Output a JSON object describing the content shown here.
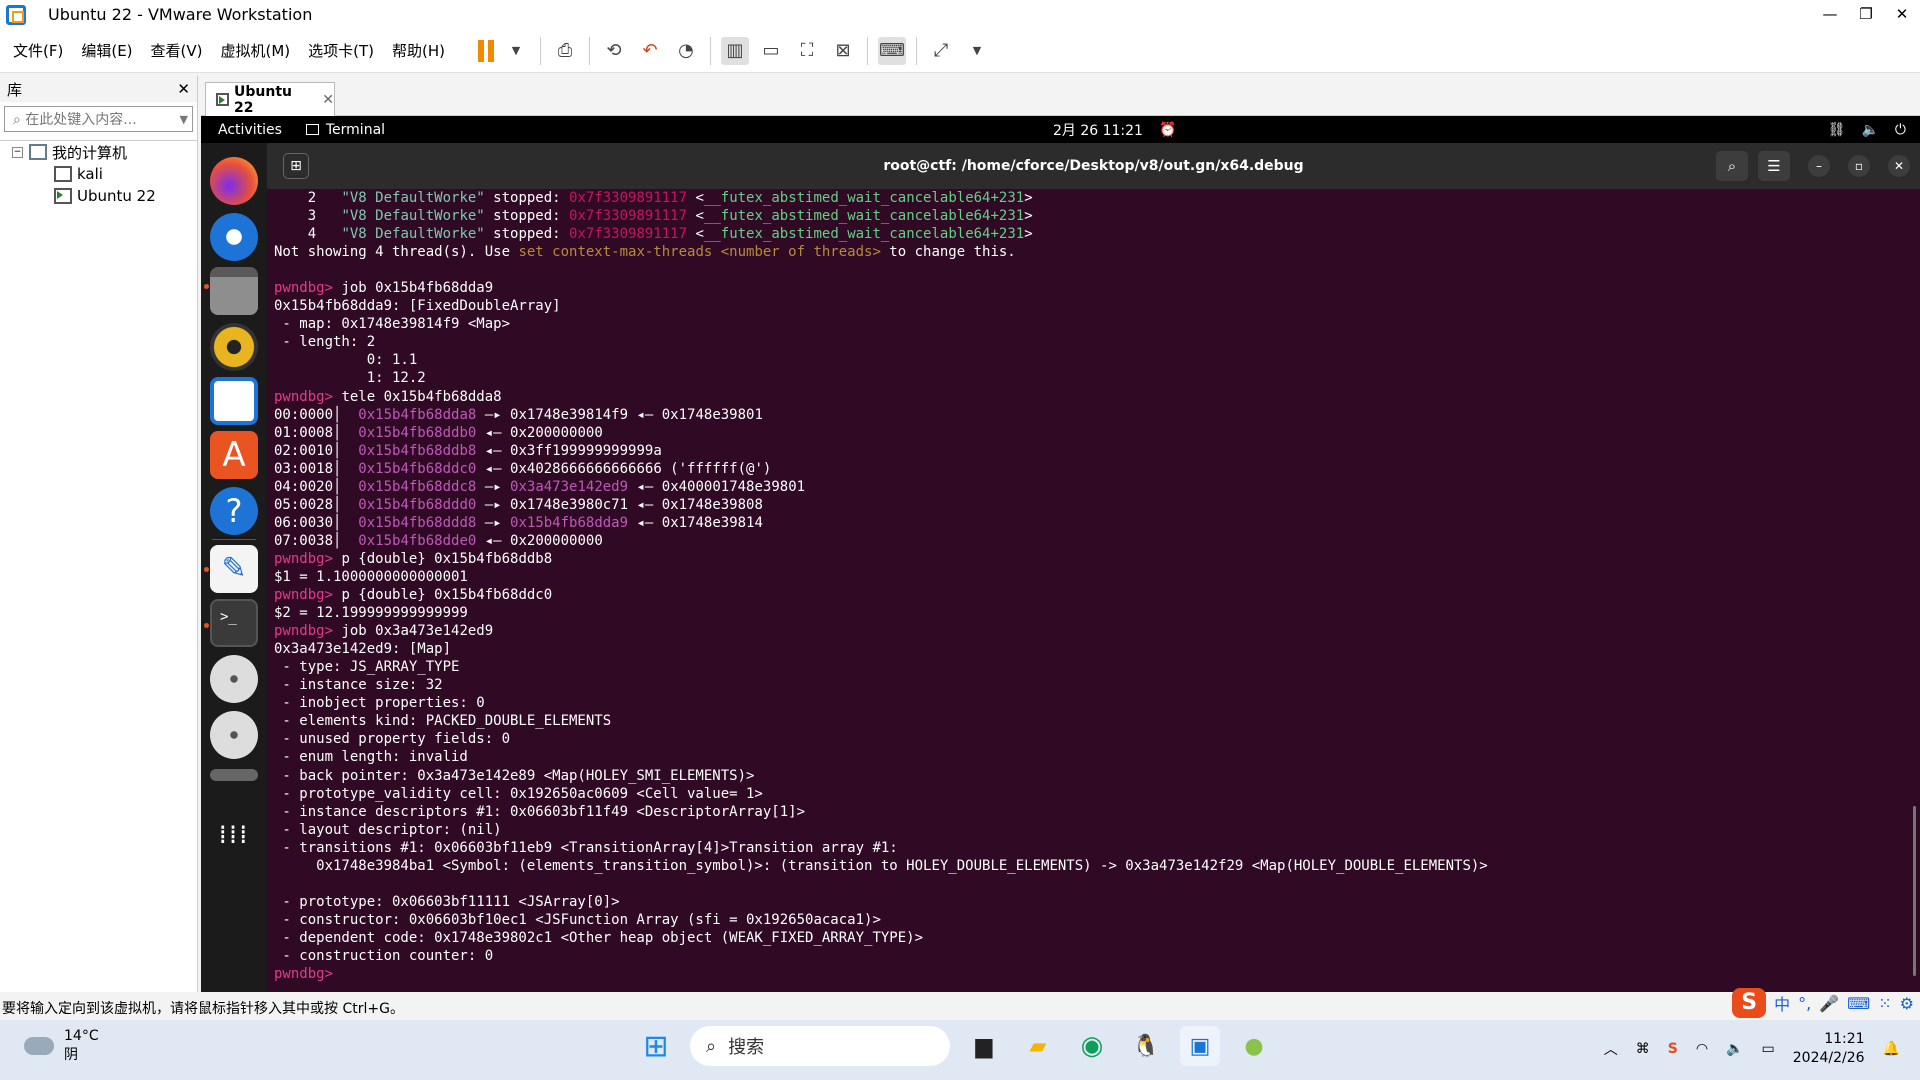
{
  "window": {
    "title": "Ubuntu 22 - VMware Workstation"
  },
  "menu": [
    "文件(F)",
    "编辑(E)",
    "查看(V)",
    "虚拟机(M)",
    "选项卡(T)",
    "帮助(H)"
  ],
  "library": {
    "title": "库",
    "close": "✕",
    "search_placeholder": "在此处键入内容...",
    "root": "我的计算机",
    "vms": [
      "kali",
      "Ubuntu 22"
    ]
  },
  "tab": {
    "label": "Ubuntu 22",
    "close": "✕"
  },
  "guest": {
    "activities": "Activities",
    "terminal": "Terminal",
    "clock": "2月 26  11:21"
  },
  "term": {
    "title": "root@ctf: /home/cforce/Desktop/v8/out.gn/x64.debug"
  },
  "lines": [
    [
      [
        "    2   ",
        ""
      ],
      [
        "\"V8 DefaultWorke\"",
        "g"
      ],
      [
        " stopped: ",
        ""
      ],
      [
        "0x7f3309891117",
        "r"
      ],
      [
        " <",
        ""
      ],
      [
        "__futex_abstimed_wait_cancelable64+231",
        "gr"
      ],
      [
        ">",
        ""
      ]
    ],
    [
      [
        "    3   ",
        ""
      ],
      [
        "\"V8 DefaultWorke\"",
        "g"
      ],
      [
        " stopped: ",
        ""
      ],
      [
        "0x7f3309891117",
        "r"
      ],
      [
        " <",
        ""
      ],
      [
        "__futex_abstimed_wait_cancelable64+231",
        "gr"
      ],
      [
        ">",
        ""
      ]
    ],
    [
      [
        "    4   ",
        ""
      ],
      [
        "\"V8 DefaultWorke\"",
        "g"
      ],
      [
        " stopped: ",
        ""
      ],
      [
        "0x7f3309891117",
        "r"
      ],
      [
        " <",
        ""
      ],
      [
        "__futex_abstimed_wait_cancelable64+231",
        "gr"
      ],
      [
        ">",
        ""
      ]
    ],
    [
      [
        "Not showing 4 thread(s). Use ",
        ""
      ],
      [
        "set context-max-threads <number of threads>",
        "y"
      ],
      [
        " to change this.",
        ""
      ]
    ],
    [
      [
        "",
        ""
      ]
    ],
    [
      [
        "pwndbg> ",
        "p"
      ],
      [
        "job 0x15b4fb68dda9",
        ""
      ]
    ],
    [
      [
        "0x15b4fb68dda9: [FixedDoubleArray]",
        ""
      ]
    ],
    [
      [
        " - map: 0x1748e39814f9 <Map>",
        ""
      ]
    ],
    [
      [
        " - length: 2",
        ""
      ]
    ],
    [
      [
        "           0: 1.1",
        ""
      ]
    ],
    [
      [
        "           1: 12.2",
        ""
      ]
    ],
    [
      [
        "pwndbg> ",
        "p"
      ],
      [
        "tele 0x15b4fb68dda8",
        ""
      ]
    ],
    [
      [
        "00:0000│  ",
        ""
      ],
      [
        "0x15b4fb68dda8",
        "m"
      ],
      [
        " —▸ 0x1748e39814f9 ◂— 0x1748e39801",
        ""
      ]
    ],
    [
      [
        "01:0008│  ",
        ""
      ],
      [
        "0x15b4fb68ddb0",
        "m"
      ],
      [
        " ◂— 0x200000000",
        ""
      ]
    ],
    [
      [
        "02:0010│  ",
        ""
      ],
      [
        "0x15b4fb68ddb8",
        "m"
      ],
      [
        " ◂— 0x3ff199999999999a",
        ""
      ]
    ],
    [
      [
        "03:0018│  ",
        ""
      ],
      [
        "0x15b4fb68ddc0",
        "m"
      ],
      [
        " ◂— 0x4028666666666666 ('ffffff(@')",
        ""
      ]
    ],
    [
      [
        "04:0020│  ",
        ""
      ],
      [
        "0x15b4fb68ddc8",
        "m"
      ],
      [
        " —▸ ",
        ""
      ],
      [
        "0x3a473e142ed9",
        "m"
      ],
      [
        " ◂— 0x400001748e39801",
        ""
      ]
    ],
    [
      [
        "05:0028│  ",
        ""
      ],
      [
        "0x15b4fb68ddd0",
        "m"
      ],
      [
        " —▸ 0x1748e3980c71 ◂— 0x1748e39808",
        ""
      ]
    ],
    [
      [
        "06:0030│  ",
        ""
      ],
      [
        "0x15b4fb68ddd8",
        "m"
      ],
      [
        " —▸ ",
        ""
      ],
      [
        "0x15b4fb68dda9",
        "m"
      ],
      [
        " ◂— 0x1748e39814",
        ""
      ]
    ],
    [
      [
        "07:0038│  ",
        ""
      ],
      [
        "0x15b4fb68dde0",
        "m"
      ],
      [
        " ◂— 0x200000000",
        ""
      ]
    ],
    [
      [
        "pwndbg> ",
        "p"
      ],
      [
        "p {double} 0x15b4fb68ddb8",
        ""
      ]
    ],
    [
      [
        "$1 = 1.1000000000000001",
        ""
      ]
    ],
    [
      [
        "pwndbg> ",
        "p"
      ],
      [
        "p {double} 0x15b4fb68ddc0",
        ""
      ]
    ],
    [
      [
        "$2 = 12.199999999999999",
        ""
      ]
    ],
    [
      [
        "pwndbg> ",
        "p"
      ],
      [
        "job 0x3a473e142ed9",
        ""
      ]
    ],
    [
      [
        "0x3a473e142ed9: [Map]",
        ""
      ]
    ],
    [
      [
        " - type: JS_ARRAY_TYPE",
        ""
      ]
    ],
    [
      [
        " - instance size: 32",
        ""
      ]
    ],
    [
      [
        " - inobject properties: 0",
        ""
      ]
    ],
    [
      [
        " - elements kind: PACKED_DOUBLE_ELEMENTS",
        ""
      ]
    ],
    [
      [
        " - unused property fields: 0",
        ""
      ]
    ],
    [
      [
        " - enum length: invalid",
        ""
      ]
    ],
    [
      [
        " - back pointer: 0x3a473e142e89 <Map(HOLEY_SMI_ELEMENTS)>",
        ""
      ]
    ],
    [
      [
        " - prototype_validity cell: 0x192650ac0609 <Cell value= 1>",
        ""
      ]
    ],
    [
      [
        " - instance descriptors #1: 0x06603bf11f49 <DescriptorArray[1]>",
        ""
      ]
    ],
    [
      [
        " - layout descriptor: (nil)",
        ""
      ]
    ],
    [
      [
        " - transitions #1: 0x06603bf11eb9 <TransitionArray[4]>Transition array #1:",
        ""
      ]
    ],
    [
      [
        "     0x1748e3984ba1 <Symbol: (elements_transition_symbol)>: (transition to HOLEY_DOUBLE_ELEMENTS) -> 0x3a473e142f29 <Map(HOLEY_DOUBLE_ELEMENTS)>",
        ""
      ]
    ],
    [
      [
        "",
        ""
      ]
    ],
    [
      [
        " - prototype: 0x06603bf11111 <JSArray[0]>",
        ""
      ]
    ],
    [
      [
        " - constructor: 0x06603bf10ec1 <JSFunction Array (sfi = 0x192650acaca1)>",
        ""
      ]
    ],
    [
      [
        " - dependent code: 0x1748e39802c1 <Other heap object (WEAK_FIXED_ARRAY_TYPE)>",
        ""
      ]
    ],
    [
      [
        " - construction counter: 0",
        ""
      ]
    ],
    [
      [
        "pwndbg> ",
        "p"
      ]
    ]
  ],
  "status": "要将输入定向到该虚拟机，请将鼠标指针移入其中或按 Ctrl+G。",
  "ime": [
    "中",
    "°,",
    "🎤",
    "⌨",
    "⁙",
    "⚙"
  ],
  "taskbar": {
    "temp": "14°C",
    "weather": "阴",
    "search": "搜索",
    "time": "11:21",
    "date": "2024/2/26"
  }
}
